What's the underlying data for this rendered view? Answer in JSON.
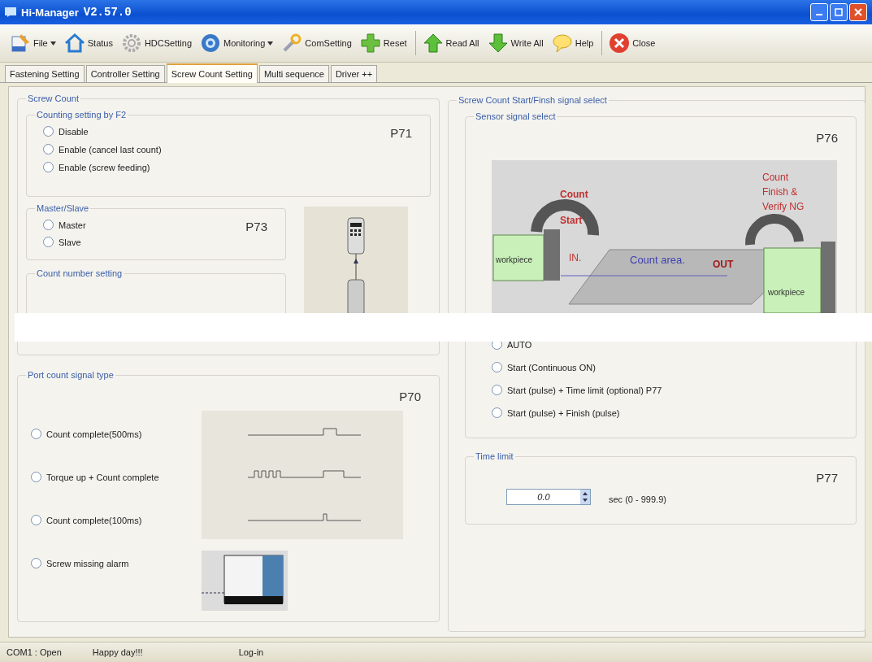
{
  "window": {
    "title": "Hi-Manager",
    "version": "V2.57.0"
  },
  "toolbar": [
    {
      "label": "File",
      "dropdown": true,
      "separator_before": false
    },
    {
      "label": "Status",
      "dropdown": false,
      "separator_before": false
    },
    {
      "label": "HDCSetting",
      "dropdown": false,
      "separator_before": false
    },
    {
      "label": "Monitoring",
      "dropdown": true,
      "separator_before": false
    },
    {
      "label": "ComSetting",
      "dropdown": false,
      "separator_before": false
    },
    {
      "label": "Reset",
      "dropdown": false,
      "separator_before": false
    },
    {
      "label": "Read All",
      "dropdown": false,
      "separator_before": true
    },
    {
      "label": "Write All",
      "dropdown": false,
      "separator_before": false
    },
    {
      "label": "Help",
      "dropdown": false,
      "separator_before": false
    },
    {
      "label": "Close",
      "dropdown": false,
      "separator_before": true
    }
  ],
  "tabs": [
    {
      "label": "Fastening Setting",
      "selected": false
    },
    {
      "label": "Controller Setting",
      "selected": false
    },
    {
      "label": "Screw Count Setting",
      "selected": true
    },
    {
      "label": "Multi sequence",
      "selected": false
    },
    {
      "label": "Driver ++",
      "selected": false
    }
  ],
  "screw_count": {
    "title": "Screw Count",
    "counting_setting": {
      "title": "Counting setting by F2",
      "code": "P71",
      "options": [
        {
          "label": "Disable",
          "selected": false
        },
        {
          "label": "Enable (cancel last count)",
          "selected": false
        },
        {
          "label": "Enable (screw feeding)",
          "selected": false
        }
      ]
    },
    "master_slave": {
      "title": "Master/Slave",
      "code": "P73",
      "options": [
        {
          "label": "Master",
          "selected": false
        },
        {
          "label": "Slave",
          "selected": false
        }
      ]
    },
    "count_number": {
      "title": "Count number setting"
    }
  },
  "port_count": {
    "title": "Port count signal type",
    "code": "P70",
    "options": [
      {
        "label": "Count complete(500ms)",
        "selected": false
      },
      {
        "label": "Torque up + Count complete",
        "selected": false
      },
      {
        "label": "Count complete(100ms)",
        "selected": false
      },
      {
        "label": "Screw missing alarm",
        "selected": false
      }
    ]
  },
  "signal_select": {
    "title": "Screw Count Start/Finsh signal select",
    "sensor": {
      "title": "Sensor signal select",
      "code": "P76",
      "diagram": {
        "start_label": [
          "Count",
          "Start"
        ],
        "finish_label": [
          "Count",
          "Finish &",
          "Verify NG"
        ],
        "in_label": "IN.",
        "out_label": "OUT",
        "area_label": "Count area.",
        "workpiece_left": "workpiece",
        "workpiece_right": "workpiece"
      },
      "options": [
        {
          "label": "AUTO",
          "selected": false
        },
        {
          "label": "Start (Continuous ON)",
          "selected": false
        },
        {
          "label": "Start (pulse) + Time limit (optional) P77",
          "selected": false
        },
        {
          "label": "Start (pulse) + Finish (pulse)",
          "selected": false
        }
      ]
    },
    "time_limit": {
      "title": "Time limit",
      "code": "P77",
      "value": "0.0",
      "range": "sec (0 - 999.9)"
    }
  },
  "status_bar": [
    "COM1 : Open",
    "Happy day!!!",
    "Log-in"
  ]
}
